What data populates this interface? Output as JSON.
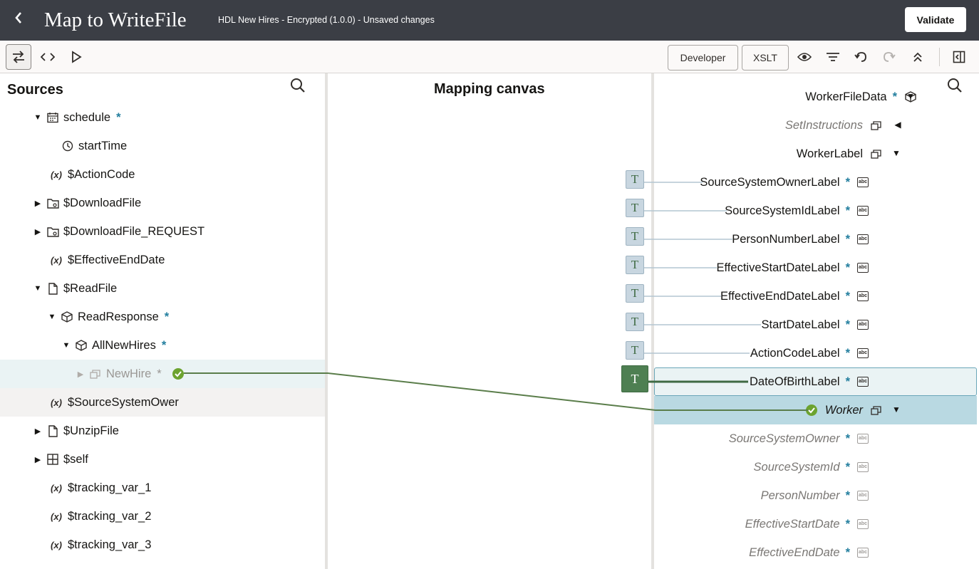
{
  "header": {
    "title": "Map to WriteFile",
    "subtitle": "HDL New Hires - Encrypted (1.0.0) - Unsaved changes",
    "validate_label": "Validate",
    "back_icon": "chevron-left-icon"
  },
  "toolbar": {
    "developer_label": "Developer",
    "xslt_label": "XSLT"
  },
  "sources": {
    "title": "Sources",
    "items": [
      {
        "label": "schedule",
        "required": "*"
      },
      {
        "label": "startTime"
      },
      {
        "label": "$ActionCode"
      },
      {
        "label": "$DownloadFile"
      },
      {
        "label": "$DownloadFile_REQUEST"
      },
      {
        "label": "$EffectiveEndDate"
      },
      {
        "label": "$ReadFile"
      },
      {
        "label": "ReadResponse",
        "required": "*"
      },
      {
        "label": "AllNewHires",
        "required": "*"
      },
      {
        "label": "NewHire",
        "required": "*"
      },
      {
        "label": "$SourceSystemOwer"
      },
      {
        "label": "$UnzipFile"
      },
      {
        "label": "$self"
      },
      {
        "label": "$tracking_var_1"
      },
      {
        "label": "$tracking_var_2"
      },
      {
        "label": "$tracking_var_3"
      }
    ]
  },
  "canvas": {
    "title": "Mapping canvas",
    "fn_symbol": "T"
  },
  "target": {
    "items": [
      {
        "label": "WorkerFileData",
        "required": "*"
      },
      {
        "label": "SetInstructions"
      },
      {
        "label": "WorkerLabel"
      },
      {
        "label": "SourceSystemOwnerLabel",
        "required": "*"
      },
      {
        "label": "SourceSystemIdLabel",
        "required": "*"
      },
      {
        "label": "PersonNumberLabel",
        "required": "*"
      },
      {
        "label": "EffectiveStartDateLabel",
        "required": "*"
      },
      {
        "label": "EffectiveEndDateLabel",
        "required": "*"
      },
      {
        "label": "StartDateLabel",
        "required": "*"
      },
      {
        "label": "ActionCodeLabel",
        "required": "*"
      },
      {
        "label": "DateOfBirthLabel",
        "required": "*"
      },
      {
        "label": "Worker"
      },
      {
        "label": "SourceSystemOwner",
        "required": "*"
      },
      {
        "label": "SourceSystemId",
        "required": "*"
      },
      {
        "label": "PersonNumber",
        "required": "*"
      },
      {
        "label": "EffectiveStartDate",
        "required": "*"
      },
      {
        "label": "EffectiveEndDate",
        "required": "*"
      }
    ],
    "string_icon_text": "abc"
  },
  "colors": {
    "header_bg": "#3b3e45",
    "accent_required": "#227e9e",
    "mapped_line": "#5a7d4a",
    "selected_row": "#eaf3f4",
    "active_row": "#b9d9e2"
  }
}
